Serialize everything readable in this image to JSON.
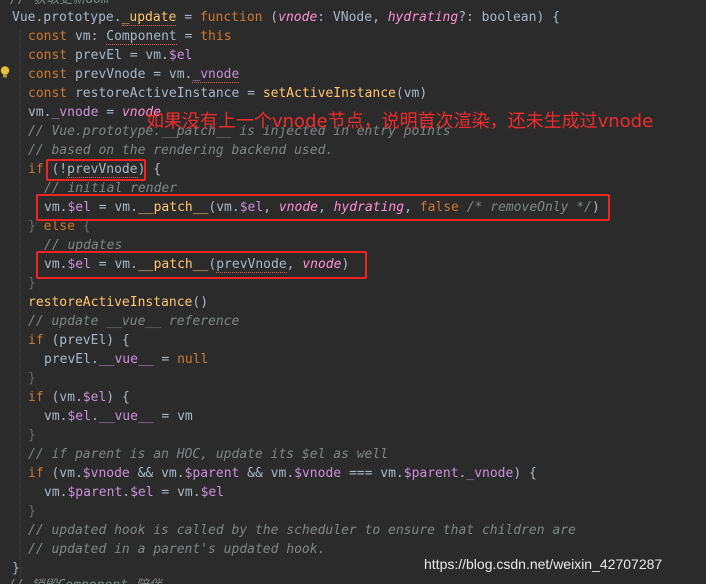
{
  "code": {
    "l0": "// 获取更新dom",
    "l1": [
      "Vue.prototype.",
      "_update",
      " = ",
      "function",
      " (",
      "vnode",
      ": VNode, ",
      "hydrating",
      "?: boolean) {"
    ],
    "l2": [
      "const",
      " vm: ",
      "Component",
      " = ",
      "this"
    ],
    "l3": [
      "const",
      " prevEl = vm.",
      "$el"
    ],
    "l4": [
      "const",
      " prevVnode = vm.",
      "_vnode"
    ],
    "l5": [
      "const",
      " restoreActiveInstance = ",
      "setActiveInstance",
      "(vm)"
    ],
    "l6": [
      "vm.",
      "_vnode",
      " = ",
      "vnode"
    ],
    "l7": "// Vue.prototype.__patch__ is injected in entry points",
    "l8": "// based on the rendering backend used.",
    "l9": [
      "if",
      " (!",
      "prevVnode",
      ") {"
    ],
    "l10": "// initial render",
    "l11": [
      "vm.",
      "$el",
      " = vm.",
      "__patch__",
      "(vm.",
      "$el",
      ", ",
      "vnode",
      ", ",
      "hydrating",
      ", ",
      "false",
      " ",
      "/* removeOnly */",
      ")"
    ],
    "l12": [
      "} ",
      "else",
      " {"
    ],
    "l13": "// updates",
    "l14": [
      "vm.",
      "$el",
      " = vm.",
      "__patch__",
      "(",
      "prevVnode",
      ", ",
      "vnode",
      ")"
    ],
    "l15": "}",
    "l16": [
      "restoreActiveInstance",
      "()"
    ],
    "l17": "// update __vue__ reference",
    "l18": [
      "if",
      " (prevEl) {"
    ],
    "l19": [
      "prevEl.",
      "__vue__",
      " = ",
      "null"
    ],
    "l20": "}",
    "l21": [
      "if",
      " (vm.",
      "$el",
      ") {"
    ],
    "l22": [
      "vm.",
      "$el",
      ".",
      "__vue__",
      " = vm"
    ],
    "l23": "}",
    "l24": "// if parent is an HOC, update its $el as well",
    "l25": [
      "if",
      " (vm.",
      "$vnode",
      " && vm.",
      "$parent",
      " && vm.",
      "$vnode",
      " === vm.",
      "$parent",
      ".",
      "_vnode",
      ") {"
    ],
    "l26": [
      "vm.",
      "$parent",
      ".",
      "$el",
      " = vm.",
      "$el"
    ],
    "l27": "}",
    "l28": "// updated hook is called by the scheduler to ensure that children are",
    "l29": "// updated in a parent's updated hook.",
    "l30": "}",
    "l31": "// 销毁Component 陪伴"
  },
  "annotation": {
    "text": "如果没有上一个vnode节点，说明首次渲染，还未生成过vnode"
  },
  "watermark": {
    "text": "https://blog.csdn.net/weixin_42707287"
  },
  "colors": {
    "background": "#2b2b2b",
    "keyword": "#cc7832",
    "function": "#ffc66d",
    "param": "#ff8fd2",
    "comment": "#7f8686",
    "property": "#c990d8",
    "highlight_box": "#f02424"
  },
  "icons": {
    "gutter": "lightbulb-icon"
  }
}
